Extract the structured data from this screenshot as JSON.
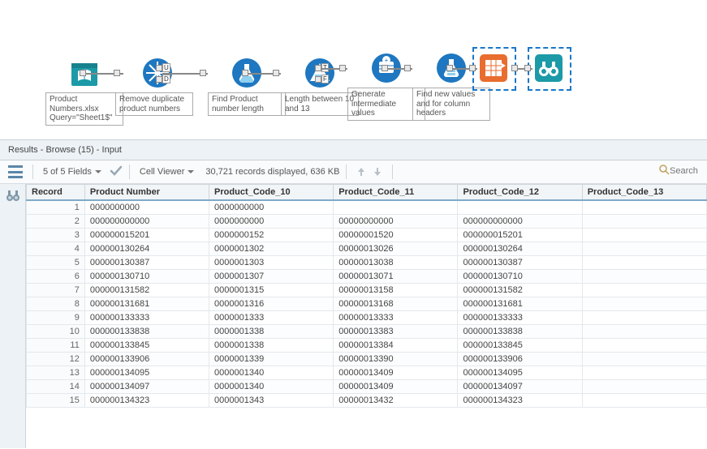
{
  "workflow": {
    "nodes": [
      {
        "id": "input",
        "label": "Product Numbers.xlsx\nQuery=\"Sheet1$\""
      },
      {
        "id": "unique",
        "label": "Remove duplicate product numbers"
      },
      {
        "id": "formula",
        "label": "Find Product number length"
      },
      {
        "id": "filter",
        "label": "Length between 10 and 13"
      },
      {
        "id": "genrows",
        "label": "Generate intermediate values"
      },
      {
        "id": "multirow",
        "label": "Find new values and for column headers"
      },
      {
        "id": "crosstab",
        "label": ""
      },
      {
        "id": "browse",
        "label": ""
      }
    ]
  },
  "results_header": "Results - Browse (15) - Input",
  "toolbar": {
    "fields_text": "5 of 5 Fields",
    "cell_viewer": "Cell Viewer",
    "records_text": "30,721 records displayed, 636 KB",
    "search_placeholder": "Search"
  },
  "table": {
    "columns": [
      "Record",
      "Product Number",
      "Product_Code_10",
      "Product_Code_11",
      "Product_Code_12",
      "Product_Code_13"
    ],
    "rows": [
      [
        "1",
        "0000000000",
        "0000000000",
        "",
        "",
        ""
      ],
      [
        "2",
        "000000000000",
        "0000000000",
        "00000000000",
        "000000000000",
        ""
      ],
      [
        "3",
        "000000015201",
        "0000000152",
        "00000001520",
        "000000015201",
        ""
      ],
      [
        "4",
        "000000130264",
        "0000001302",
        "00000013026",
        "000000130264",
        ""
      ],
      [
        "5",
        "000000130387",
        "0000001303",
        "00000013038",
        "000000130387",
        ""
      ],
      [
        "6",
        "000000130710",
        "0000001307",
        "00000013071",
        "000000130710",
        ""
      ],
      [
        "7",
        "000000131582",
        "0000001315",
        "00000013158",
        "000000131582",
        ""
      ],
      [
        "8",
        "000000131681",
        "0000001316",
        "00000013168",
        "000000131681",
        ""
      ],
      [
        "9",
        "000000133333",
        "0000001333",
        "00000013333",
        "000000133333",
        ""
      ],
      [
        "10",
        "000000133838",
        "0000001338",
        "00000013383",
        "000000133838",
        ""
      ],
      [
        "11",
        "000000133845",
        "0000001338",
        "00000013384",
        "000000133845",
        ""
      ],
      [
        "12",
        "000000133906",
        "0000001339",
        "00000013390",
        "000000133906",
        ""
      ],
      [
        "13",
        "000000134095",
        "0000001340",
        "00000013409",
        "000000134095",
        ""
      ],
      [
        "14",
        "000000134097",
        "0000001340",
        "00000013409",
        "000000134097",
        ""
      ],
      [
        "15",
        "000000134323",
        "0000001343",
        "00000013432",
        "000000134323",
        ""
      ]
    ]
  },
  "colors": {
    "teal": "#2a8f9c",
    "blue": "#1e77c0",
    "orange": "#e86d2f"
  }
}
